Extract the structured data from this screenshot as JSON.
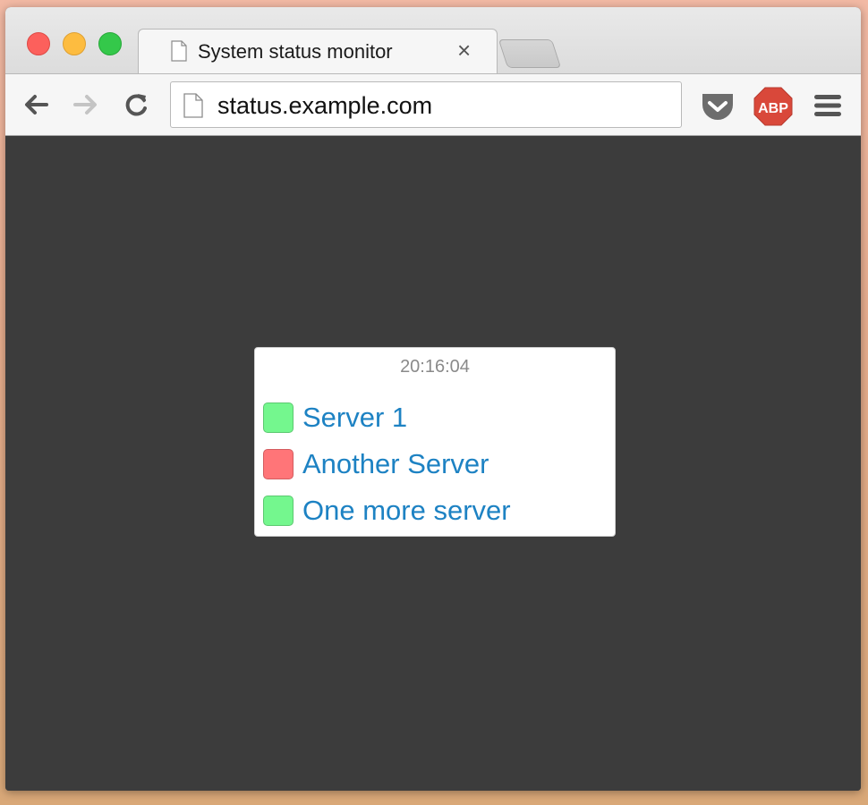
{
  "browser": {
    "tab": {
      "title": "System status monitor",
      "close_glyph": "×",
      "icon": "document-icon"
    },
    "toolbar": {
      "back_icon": "back-arrow-icon",
      "forward_icon": "forward-arrow-icon",
      "reload_icon": "reload-icon",
      "url": "status.example.com",
      "page_icon": "document-icon",
      "extensions": [
        "pocket-icon",
        "adblock-plus-icon"
      ],
      "abp_label": "ABP",
      "menu_icon": "hamburger-menu-icon"
    }
  },
  "status": {
    "time": "20:16:04",
    "servers": [
      {
        "name": "Server 1",
        "state": "up"
      },
      {
        "name": "Another Server",
        "state": "down"
      },
      {
        "name": "One more server",
        "state": "up"
      }
    ]
  },
  "colors": {
    "page_background": "#3c3c3c",
    "status_up": "#74f78e",
    "status_down": "#ff7578",
    "link": "#1d82c3",
    "time_text": "#8a8a8a"
  }
}
